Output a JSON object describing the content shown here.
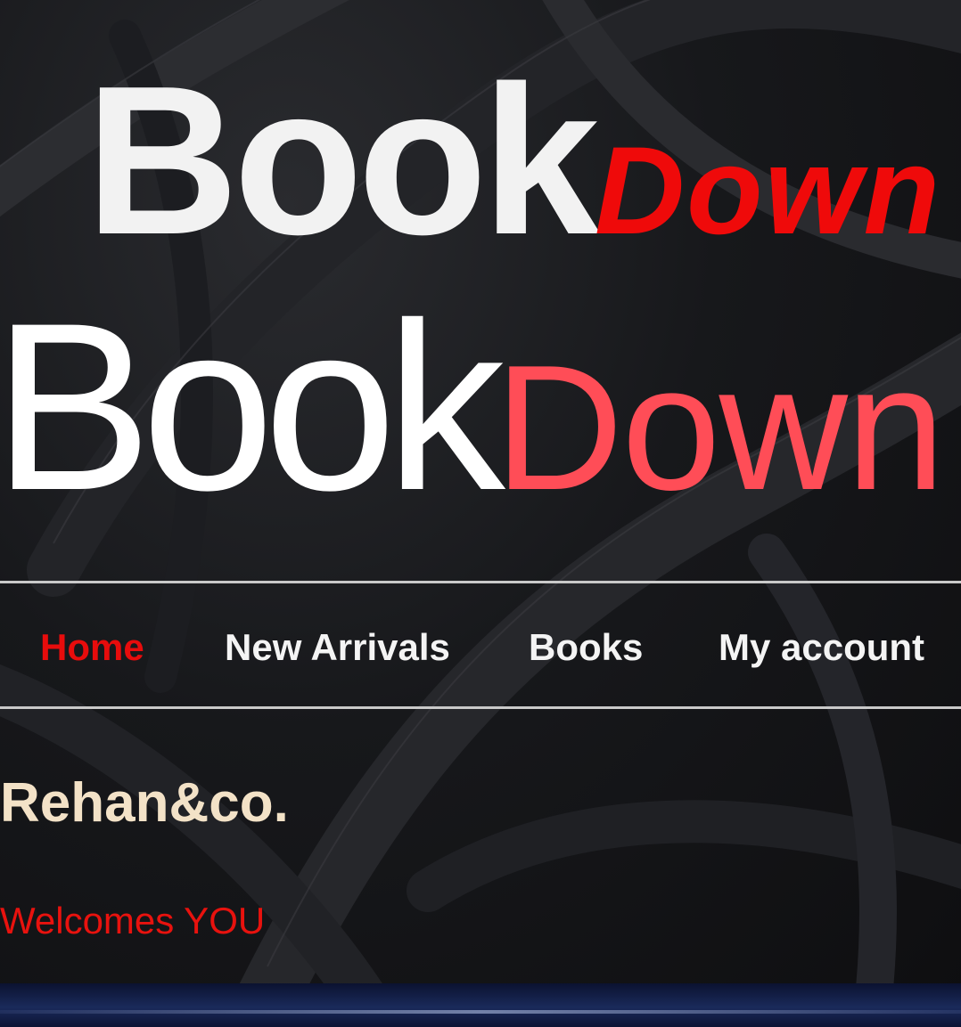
{
  "logo_primary": {
    "book": "Book",
    "down": "Down"
  },
  "logo_secondary": {
    "book": "Book",
    "down": "Down"
  },
  "nav": {
    "items": [
      {
        "label": "Home",
        "active": true
      },
      {
        "label": "New Arrivals",
        "active": false
      },
      {
        "label": "Books",
        "active": false
      },
      {
        "label": "My account",
        "active": false
      }
    ]
  },
  "brand": "Rehan&co.",
  "tagline": "Welcomes YOU",
  "colors": {
    "active_nav": "#e80c0c",
    "logo_down_primary": "#ef0a0a",
    "logo_down_secondary": "#ff4d57",
    "brand_text": "#f3e2c7",
    "tagline": "#e8120e"
  }
}
